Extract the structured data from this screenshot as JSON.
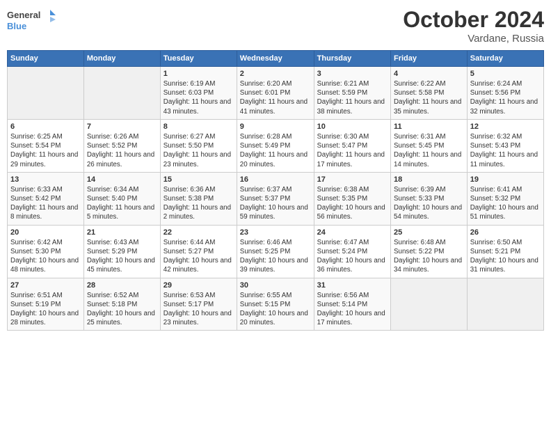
{
  "logo": {
    "general": "General",
    "blue": "Blue"
  },
  "title": "October 2024",
  "location": "Vardane, Russia",
  "days_header": [
    "Sunday",
    "Monday",
    "Tuesday",
    "Wednesday",
    "Thursday",
    "Friday",
    "Saturday"
  ],
  "weeks": [
    [
      {
        "day": "",
        "content": ""
      },
      {
        "day": "",
        "content": ""
      },
      {
        "day": "1",
        "content": "Sunrise: 6:19 AM\nSunset: 6:03 PM\nDaylight: 11 hours and 43 minutes."
      },
      {
        "day": "2",
        "content": "Sunrise: 6:20 AM\nSunset: 6:01 PM\nDaylight: 11 hours and 41 minutes."
      },
      {
        "day": "3",
        "content": "Sunrise: 6:21 AM\nSunset: 5:59 PM\nDaylight: 11 hours and 38 minutes."
      },
      {
        "day": "4",
        "content": "Sunrise: 6:22 AM\nSunset: 5:58 PM\nDaylight: 11 hours and 35 minutes."
      },
      {
        "day": "5",
        "content": "Sunrise: 6:24 AM\nSunset: 5:56 PM\nDaylight: 11 hours and 32 minutes."
      }
    ],
    [
      {
        "day": "6",
        "content": "Sunrise: 6:25 AM\nSunset: 5:54 PM\nDaylight: 11 hours and 29 minutes."
      },
      {
        "day": "7",
        "content": "Sunrise: 6:26 AM\nSunset: 5:52 PM\nDaylight: 11 hours and 26 minutes."
      },
      {
        "day": "8",
        "content": "Sunrise: 6:27 AM\nSunset: 5:50 PM\nDaylight: 11 hours and 23 minutes."
      },
      {
        "day": "9",
        "content": "Sunrise: 6:28 AM\nSunset: 5:49 PM\nDaylight: 11 hours and 20 minutes."
      },
      {
        "day": "10",
        "content": "Sunrise: 6:30 AM\nSunset: 5:47 PM\nDaylight: 11 hours and 17 minutes."
      },
      {
        "day": "11",
        "content": "Sunrise: 6:31 AM\nSunset: 5:45 PM\nDaylight: 11 hours and 14 minutes."
      },
      {
        "day": "12",
        "content": "Sunrise: 6:32 AM\nSunset: 5:43 PM\nDaylight: 11 hours and 11 minutes."
      }
    ],
    [
      {
        "day": "13",
        "content": "Sunrise: 6:33 AM\nSunset: 5:42 PM\nDaylight: 11 hours and 8 minutes."
      },
      {
        "day": "14",
        "content": "Sunrise: 6:34 AM\nSunset: 5:40 PM\nDaylight: 11 hours and 5 minutes."
      },
      {
        "day": "15",
        "content": "Sunrise: 6:36 AM\nSunset: 5:38 PM\nDaylight: 11 hours and 2 minutes."
      },
      {
        "day": "16",
        "content": "Sunrise: 6:37 AM\nSunset: 5:37 PM\nDaylight: 10 hours and 59 minutes."
      },
      {
        "day": "17",
        "content": "Sunrise: 6:38 AM\nSunset: 5:35 PM\nDaylight: 10 hours and 56 minutes."
      },
      {
        "day": "18",
        "content": "Sunrise: 6:39 AM\nSunset: 5:33 PM\nDaylight: 10 hours and 54 minutes."
      },
      {
        "day": "19",
        "content": "Sunrise: 6:41 AM\nSunset: 5:32 PM\nDaylight: 10 hours and 51 minutes."
      }
    ],
    [
      {
        "day": "20",
        "content": "Sunrise: 6:42 AM\nSunset: 5:30 PM\nDaylight: 10 hours and 48 minutes."
      },
      {
        "day": "21",
        "content": "Sunrise: 6:43 AM\nSunset: 5:29 PM\nDaylight: 10 hours and 45 minutes."
      },
      {
        "day": "22",
        "content": "Sunrise: 6:44 AM\nSunset: 5:27 PM\nDaylight: 10 hours and 42 minutes."
      },
      {
        "day": "23",
        "content": "Sunrise: 6:46 AM\nSunset: 5:25 PM\nDaylight: 10 hours and 39 minutes."
      },
      {
        "day": "24",
        "content": "Sunrise: 6:47 AM\nSunset: 5:24 PM\nDaylight: 10 hours and 36 minutes."
      },
      {
        "day": "25",
        "content": "Sunrise: 6:48 AM\nSunset: 5:22 PM\nDaylight: 10 hours and 34 minutes."
      },
      {
        "day": "26",
        "content": "Sunrise: 6:50 AM\nSunset: 5:21 PM\nDaylight: 10 hours and 31 minutes."
      }
    ],
    [
      {
        "day": "27",
        "content": "Sunrise: 6:51 AM\nSunset: 5:19 PM\nDaylight: 10 hours and 28 minutes."
      },
      {
        "day": "28",
        "content": "Sunrise: 6:52 AM\nSunset: 5:18 PM\nDaylight: 10 hours and 25 minutes."
      },
      {
        "day": "29",
        "content": "Sunrise: 6:53 AM\nSunset: 5:17 PM\nDaylight: 10 hours and 23 minutes."
      },
      {
        "day": "30",
        "content": "Sunrise: 6:55 AM\nSunset: 5:15 PM\nDaylight: 10 hours and 20 minutes."
      },
      {
        "day": "31",
        "content": "Sunrise: 6:56 AM\nSunset: 5:14 PM\nDaylight: 10 hours and 17 minutes."
      },
      {
        "day": "",
        "content": ""
      },
      {
        "day": "",
        "content": ""
      }
    ]
  ]
}
